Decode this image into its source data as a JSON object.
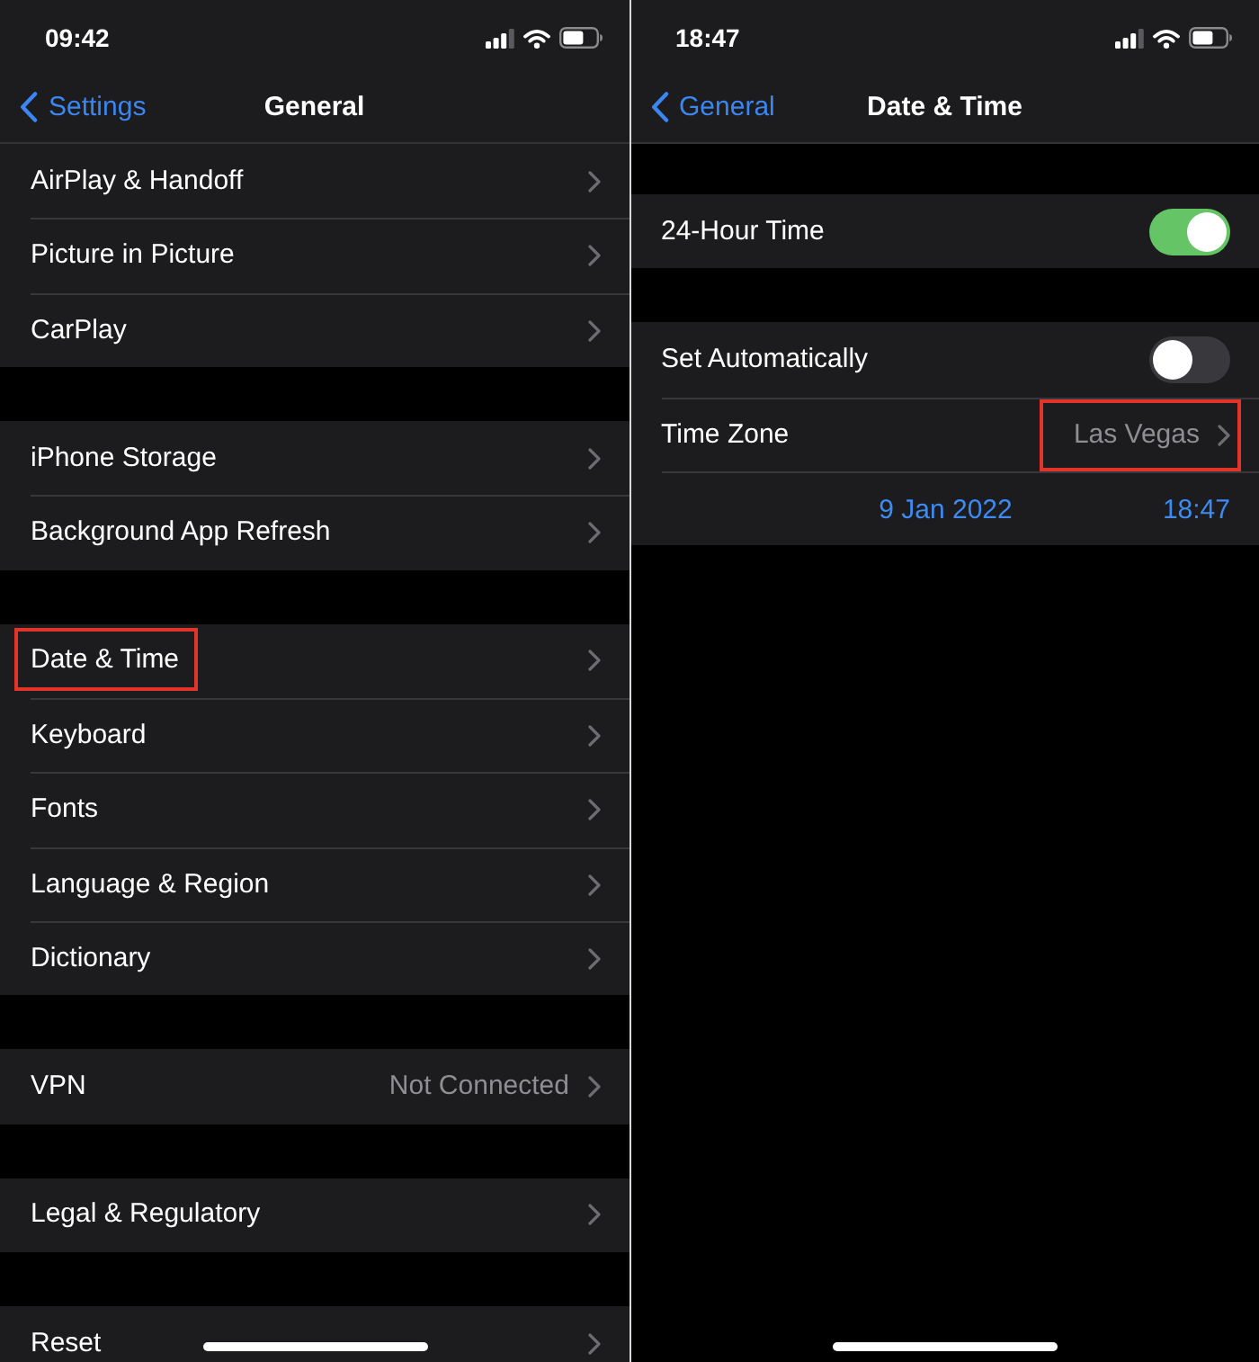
{
  "screens": [
    {
      "status_bar": {
        "time": "09:42"
      },
      "nav_bar": {
        "back": "Settings",
        "title": "General"
      },
      "groups": [
        {
          "rows": [
            {
              "kind": "link",
              "label": "AirPlay & Handoff",
              "highlighted": false
            },
            {
              "kind": "link",
              "label": "Picture in Picture",
              "highlighted": false
            },
            {
              "kind": "link",
              "label": "CarPlay",
              "highlighted": false
            }
          ]
        },
        {
          "rows": [
            {
              "kind": "link",
              "label": "iPhone Storage",
              "highlighted": false
            },
            {
              "kind": "link",
              "label": "Background App Refresh",
              "highlighted": false
            }
          ]
        },
        {
          "rows": [
            {
              "kind": "link",
              "label": "Date & Time",
              "highlighted": true
            },
            {
              "kind": "link",
              "label": "Keyboard",
              "highlighted": false
            },
            {
              "kind": "link",
              "label": "Fonts",
              "highlighted": false
            },
            {
              "kind": "link",
              "label": "Language & Region",
              "highlighted": false
            },
            {
              "kind": "link",
              "label": "Dictionary",
              "highlighted": false
            }
          ]
        },
        {
          "rows": [
            {
              "kind": "link",
              "label": "VPN",
              "value": "Not Connected",
              "highlighted": false
            }
          ]
        },
        {
          "rows": [
            {
              "kind": "link",
              "label": "Legal & Regulatory",
              "highlighted": false
            }
          ]
        },
        {
          "rows": [
            {
              "kind": "link",
              "label": "Reset",
              "highlighted": false
            }
          ]
        }
      ]
    },
    {
      "status_bar": {
        "time": "18:47"
      },
      "nav_bar": {
        "back": "General",
        "title": "Date & Time"
      },
      "groups": [
        {
          "rows": [
            {
              "kind": "toggle",
              "label": "24-Hour Time",
              "on": true
            }
          ]
        },
        {
          "rows": [
            {
              "kind": "toggle",
              "label": "Set Automatically",
              "on": false
            },
            {
              "kind": "link",
              "label": "Time Zone",
              "value": "Las Vegas",
              "highlighted": true
            },
            {
              "kind": "datetime",
              "date": "9 Jan 2022",
              "time": "18:47"
            }
          ]
        }
      ]
    }
  ]
}
